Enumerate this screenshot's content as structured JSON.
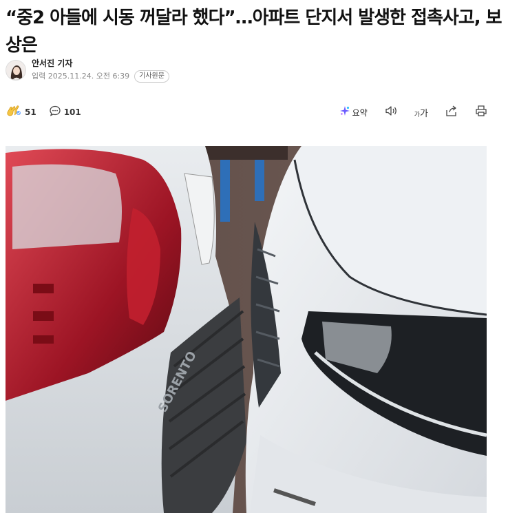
{
  "article": {
    "headline": "“중2 아들에 시동 꺼달라 했다”…아파트 단지서 발생한 접촉사고, 보상은",
    "reporter": "안서진 기자",
    "published": "입력 2025.11.24. 오전 6:39",
    "original_link_label": "기사원문"
  },
  "toolbar": {
    "reaction_count": "51",
    "comment_count": "101",
    "summary_label": "요약",
    "font_size_label": "가",
    "font_size_small": "가"
  },
  "icons": {
    "reaction": "clap-reaction-icon",
    "comment": "comment-bubble-icon",
    "summary": "ai-summary-sparkle-icon",
    "audio": "speaker-icon",
    "font": "font-size-icon",
    "share": "share-icon",
    "print": "print-icon"
  },
  "image": {
    "description_icon": "photo"
  }
}
